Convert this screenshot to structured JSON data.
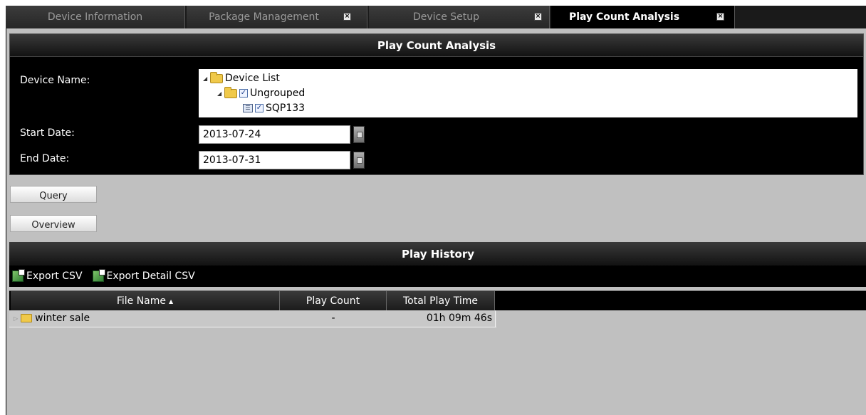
{
  "tabs": [
    {
      "label": "Device Information",
      "closable": false,
      "active": false
    },
    {
      "label": "Package Management",
      "closable": true,
      "active": false
    },
    {
      "label": "Device Setup",
      "closable": true,
      "active": false
    },
    {
      "label": "Play Count Analysis",
      "closable": true,
      "active": true
    }
  ],
  "analysis": {
    "title": "Play Count Analysis",
    "device_label": "Device Name:",
    "tree": {
      "root": "Device List",
      "group": "Ungrouped",
      "device": "SQP133"
    },
    "start_label": "Start Date:",
    "start_value": "2013-07-24",
    "end_label": "End Date:",
    "end_value": "2013-07-31"
  },
  "buttons": {
    "query": "Query",
    "overview": "Overview"
  },
  "history": {
    "title": "Play History",
    "export_csv": "Export CSV",
    "export_detail_csv": "Export Detail CSV",
    "columns": [
      "File Name",
      "Play Count",
      "Total Play Time"
    ],
    "rows": [
      {
        "file": "winter sale",
        "count": "-",
        "time": "01h 09m 46s"
      }
    ]
  }
}
